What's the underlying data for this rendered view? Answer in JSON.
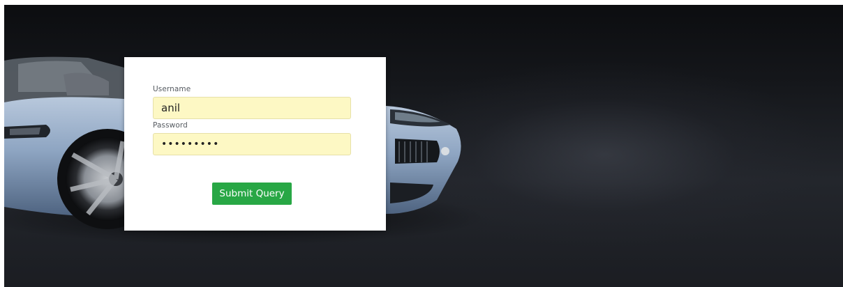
{
  "login_form": {
    "username_label": "Username",
    "username_value": "anil",
    "password_label": "Password",
    "password_value": "123456789",
    "submit_label": "Submit Query"
  },
  "background": {
    "image_subject": "car-image",
    "base_color": "#15171b",
    "car_body_color": "#8fa6c4"
  },
  "colors": {
    "submit_button": "#28a745",
    "input_autofill": "#fdf8c4"
  }
}
